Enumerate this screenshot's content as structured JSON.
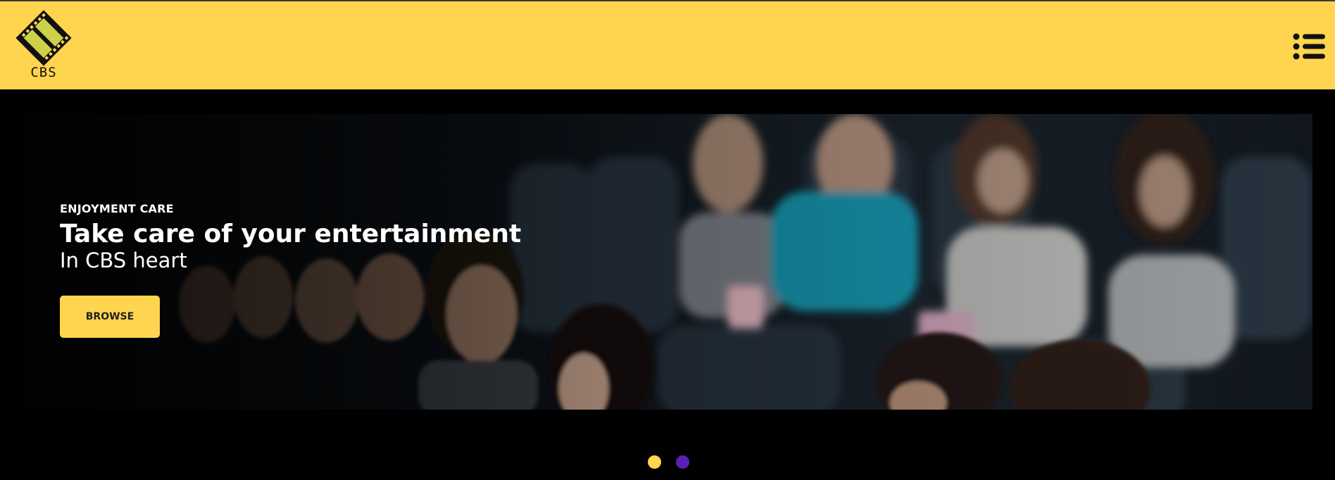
{
  "header": {
    "logo_text": "CBS",
    "menu_icon": "list-menu-icon",
    "logo_icon": "film-strip-icon"
  },
  "hero": {
    "eyebrow": "ENJOYMENT CARE",
    "title": "Take care of your entertainment",
    "subtitle": "In CBS heart",
    "button_label": "BROWSE"
  },
  "carousel": {
    "slide_count": 2,
    "active_index": 0,
    "dot_colors": [
      "#ffd54f",
      "#5b21b6"
    ]
  },
  "colors": {
    "accent": "#ffd54f",
    "background": "#000000",
    "secondary": "#5b21b6"
  }
}
